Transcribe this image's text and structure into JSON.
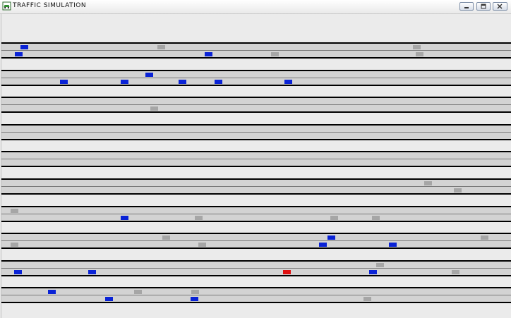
{
  "window": {
    "title": "TRAFFIC SIMULATION",
    "buttons": {
      "minimize": "minimize-icon",
      "maximize": "maximize-icon",
      "close": "close-icon"
    }
  },
  "colors": {
    "road": "#d3d3d3",
    "road_border": "#000000",
    "lane_divider": "#7a7a7a",
    "background": "#ebebeb",
    "car_blue": "#0a23d6",
    "car_gray": "#a6a6a6",
    "car_red": "#e01010"
  },
  "roads": [
    {
      "id": "road-1",
      "lanes": 2
    },
    {
      "id": "road-2",
      "lanes": 2
    },
    {
      "id": "road-3",
      "lanes": 2
    },
    {
      "id": "road-4",
      "lanes": 2
    },
    {
      "id": "road-5",
      "lanes": 2
    },
    {
      "id": "road-6",
      "lanes": 2
    },
    {
      "id": "road-7",
      "lanes": 2
    },
    {
      "id": "road-8",
      "lanes": 2
    },
    {
      "id": "road-9",
      "lanes": 2
    },
    {
      "id": "road-10",
      "lanes": 2
    }
  ],
  "vehicles": [
    {
      "road": 0,
      "lane": 0,
      "pos": 0.038,
      "color": "blue"
    },
    {
      "road": 0,
      "lane": 0,
      "pos": 0.306,
      "color": "gray"
    },
    {
      "road": 0,
      "lane": 0,
      "pos": 0.808,
      "color": "gray"
    },
    {
      "road": 0,
      "lane": 1,
      "pos": 0.027,
      "color": "blue"
    },
    {
      "road": 0,
      "lane": 1,
      "pos": 0.399,
      "color": "blue"
    },
    {
      "road": 0,
      "lane": 1,
      "pos": 0.529,
      "color": "gray"
    },
    {
      "road": 0,
      "lane": 1,
      "pos": 0.813,
      "color": "gray"
    },
    {
      "road": 1,
      "lane": 0,
      "pos": 0.283,
      "color": "blue"
    },
    {
      "road": 1,
      "lane": 1,
      "pos": 0.115,
      "color": "blue"
    },
    {
      "road": 1,
      "lane": 1,
      "pos": 0.234,
      "color": "blue"
    },
    {
      "road": 1,
      "lane": 1,
      "pos": 0.347,
      "color": "blue"
    },
    {
      "road": 1,
      "lane": 1,
      "pos": 0.418,
      "color": "blue"
    },
    {
      "road": 1,
      "lane": 1,
      "pos": 0.556,
      "color": "blue"
    },
    {
      "road": 2,
      "lane": 1,
      "pos": 0.292,
      "color": "gray"
    },
    {
      "road": 5,
      "lane": 0,
      "pos": 0.83,
      "color": "gray"
    },
    {
      "road": 5,
      "lane": 1,
      "pos": 0.888,
      "color": "gray"
    },
    {
      "road": 6,
      "lane": 0,
      "pos": 0.018,
      "color": "gray"
    },
    {
      "road": 6,
      "lane": 1,
      "pos": 0.234,
      "color": "blue"
    },
    {
      "road": 6,
      "lane": 1,
      "pos": 0.38,
      "color": "gray"
    },
    {
      "road": 6,
      "lane": 1,
      "pos": 0.645,
      "color": "gray"
    },
    {
      "road": 6,
      "lane": 1,
      "pos": 0.727,
      "color": "gray"
    },
    {
      "road": 7,
      "lane": 0,
      "pos": 0.316,
      "color": "gray"
    },
    {
      "road": 7,
      "lane": 0,
      "pos": 0.64,
      "color": "blue"
    },
    {
      "road": 7,
      "lane": 0,
      "pos": 0.94,
      "color": "gray"
    },
    {
      "road": 7,
      "lane": 1,
      "pos": 0.018,
      "color": "gray"
    },
    {
      "road": 7,
      "lane": 1,
      "pos": 0.387,
      "color": "gray"
    },
    {
      "road": 7,
      "lane": 1,
      "pos": 0.623,
      "color": "blue"
    },
    {
      "road": 7,
      "lane": 1,
      "pos": 0.761,
      "color": "blue"
    },
    {
      "road": 8,
      "lane": 0,
      "pos": 0.736,
      "color": "gray"
    },
    {
      "road": 8,
      "lane": 1,
      "pos": 0.025,
      "color": "blue"
    },
    {
      "road": 8,
      "lane": 1,
      "pos": 0.171,
      "color": "blue"
    },
    {
      "road": 8,
      "lane": 1,
      "pos": 0.553,
      "color": "red"
    },
    {
      "road": 8,
      "lane": 1,
      "pos": 0.721,
      "color": "blue"
    },
    {
      "road": 8,
      "lane": 1,
      "pos": 0.883,
      "color": "gray"
    },
    {
      "road": 9,
      "lane": 0,
      "pos": 0.092,
      "color": "blue"
    },
    {
      "road": 9,
      "lane": 0,
      "pos": 0.26,
      "color": "gray"
    },
    {
      "road": 9,
      "lane": 0,
      "pos": 0.373,
      "color": "gray"
    },
    {
      "road": 9,
      "lane": 1,
      "pos": 0.204,
      "color": "blue"
    },
    {
      "road": 9,
      "lane": 1,
      "pos": 0.371,
      "color": "blue"
    },
    {
      "road": 9,
      "lane": 1,
      "pos": 0.71,
      "color": "gray"
    }
  ]
}
